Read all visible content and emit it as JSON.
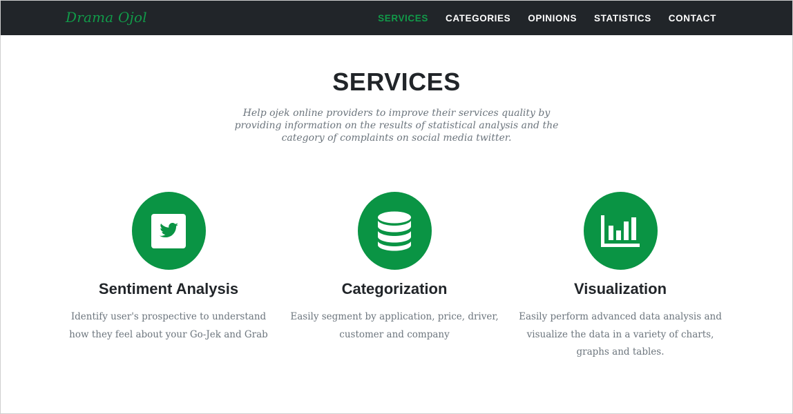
{
  "navbar": {
    "brand": "Drama Ojol",
    "links": [
      {
        "label": "SERVICES",
        "active": true
      },
      {
        "label": "CATEGORIES",
        "active": false
      },
      {
        "label": "OPINIONS",
        "active": false
      },
      {
        "label": "STATISTICS",
        "active": false
      },
      {
        "label": "CONTACT",
        "active": false
      }
    ]
  },
  "services": {
    "heading": "SERVICES",
    "subheading": "Help ojek online providers to improve their services quality by providing information on the results of statistical analysis and the category of complaints on social media twitter.",
    "items": [
      {
        "icon": "twitter-icon",
        "title": "Sentiment Analysis",
        "text": "Identify user's prospective to understand how they feel about your Go-Jek and Grab"
      },
      {
        "icon": "database-icon",
        "title": "Categorization",
        "text": "Easily segment by application, price, driver, customer and company"
      },
      {
        "icon": "bar-chart-icon",
        "title": "Visualization",
        "text": "Easily perform advanced data analysis and visualize the data in a variety of charts, graphs and tables."
      }
    ]
  },
  "colors": {
    "navbar_bg": "#212529",
    "accent_green": "#0a9444",
    "heading_text": "#212529",
    "muted_text": "#6c757d"
  }
}
